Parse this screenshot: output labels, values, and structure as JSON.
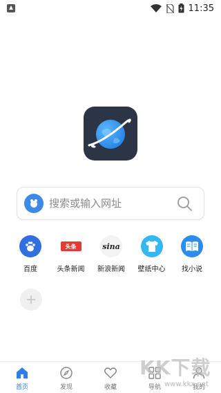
{
  "status_bar": {
    "time": "11:35"
  },
  "search": {
    "placeholder": "搜索或输入网址"
  },
  "shortcuts": [
    {
      "label": "百度",
      "icon": "baidu-paw-icon"
    },
    {
      "label": "头条新闻",
      "icon": "toutiao-icon",
      "badge_text": "头条"
    },
    {
      "label": "新浪新闻",
      "icon": "sina-icon",
      "badge_text": "sina"
    },
    {
      "label": "壁纸中心",
      "icon": "tshirt-icon"
    },
    {
      "label": "找小说",
      "icon": "book-icon"
    }
  ],
  "bottom_nav": [
    {
      "label": "首页",
      "icon": "home-icon",
      "active": true
    },
    {
      "label": "发现",
      "icon": "compass-icon"
    },
    {
      "label": "收藏",
      "icon": "heart-icon"
    },
    {
      "label": "导航",
      "icon": "grid-icon"
    },
    {
      "label": "我的",
      "icon": "user-icon"
    }
  ],
  "watermark": {
    "main": "KK下载",
    "url": "www.kkx.net"
  },
  "colors": {
    "accent": "#2f7fe6",
    "logo_bg": "#2b3546",
    "red": "#e53935"
  }
}
